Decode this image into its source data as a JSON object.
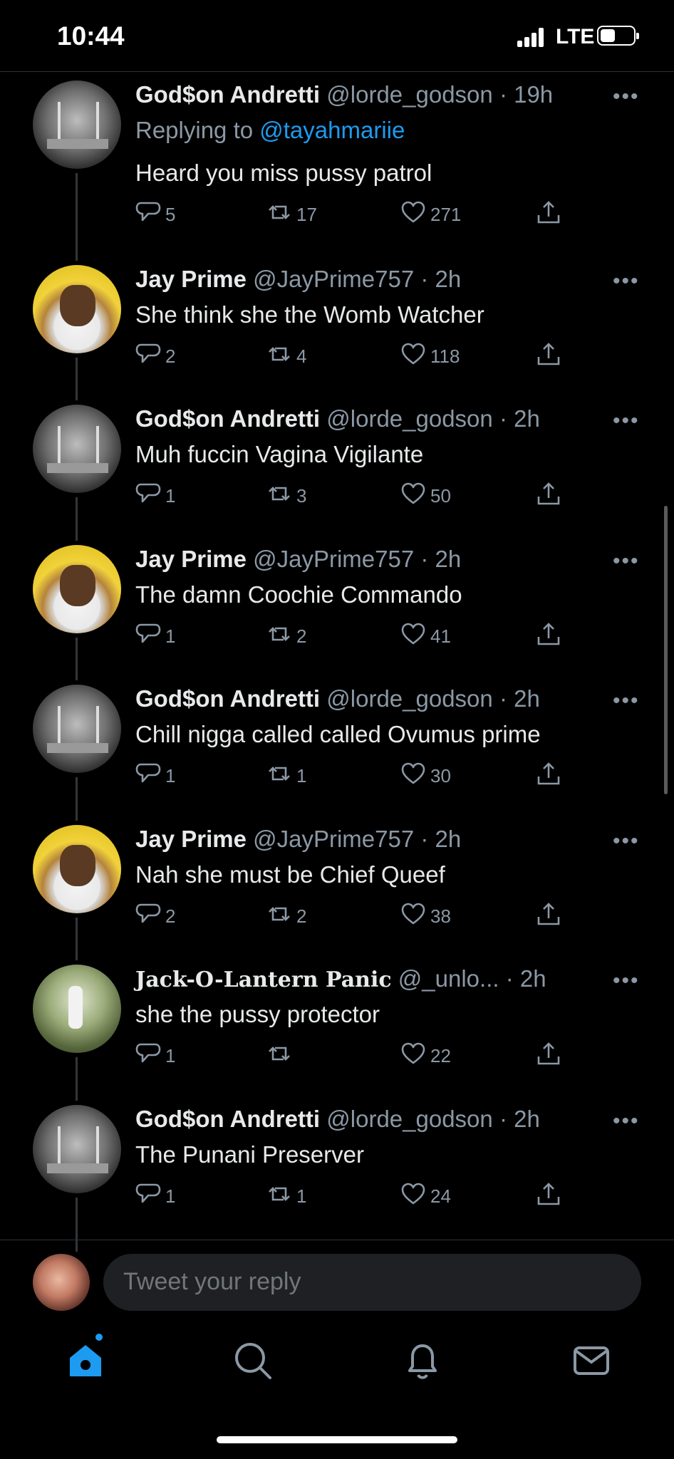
{
  "status_bar": {
    "time": "10:44",
    "network": "LTE"
  },
  "tweets": [
    {
      "avatar": "godson",
      "name": "God$on Andretti",
      "handle": "@lorde_godson",
      "time": "· 19h",
      "replying_prefix": "Replying to ",
      "replying_to": "@tayahmariie",
      "text": "Heard you miss pussy patrol",
      "replies": "5",
      "retweets": "17",
      "likes": "271"
    },
    {
      "avatar": "jay",
      "name": "Jay Prime",
      "handle": "@JayPrime757",
      "time": "· 2h",
      "text": "She think she the Womb Watcher",
      "replies": "2",
      "retweets": "4",
      "likes": "118"
    },
    {
      "avatar": "godson",
      "name": "God$on Andretti",
      "handle": "@lorde_godson",
      "time": "· 2h",
      "text": "Muh fuccin Vagina Vigilante",
      "replies": "1",
      "retweets": "3",
      "likes": "50"
    },
    {
      "avatar": "jay",
      "name": "Jay Prime",
      "handle": "@JayPrime757",
      "time": "· 2h",
      "text": "The damn Coochie Commando",
      "replies": "1",
      "retweets": "2",
      "likes": "41"
    },
    {
      "avatar": "godson",
      "name": "God$on Andretti",
      "handle": "@lorde_godson",
      "time": "· 2h",
      "text": "Chill nigga called called Ovumus prime",
      "replies": "1",
      "retweets": "1",
      "likes": "30"
    },
    {
      "avatar": "jay",
      "name": "Jay Prime",
      "handle": "@JayPrime757",
      "time": "· 2h",
      "text": "Nah she must be Chief Queef",
      "replies": "2",
      "retweets": "2",
      "likes": "38"
    },
    {
      "avatar": "jack",
      "name": "Jack-O-Lantern Panic",
      "handle": "@_unlo...",
      "time": "· 2h",
      "text": "she the pussy protector",
      "replies": "1",
      "retweets": "",
      "likes": "22"
    },
    {
      "avatar": "godson",
      "name": "God$on Andretti",
      "handle": "@lorde_godson",
      "time": "· 2h",
      "text": "The Punani Preserver",
      "replies": "1",
      "retweets": "1",
      "likes": "24"
    }
  ],
  "composer": {
    "placeholder": "Tweet your reply"
  },
  "tabs": [
    "home-icon",
    "search-icon",
    "bell-icon",
    "mail-icon"
  ],
  "colors": {
    "accent": "#1d9bf0",
    "background": "#000000",
    "secondary_text": "#8b98a5"
  }
}
